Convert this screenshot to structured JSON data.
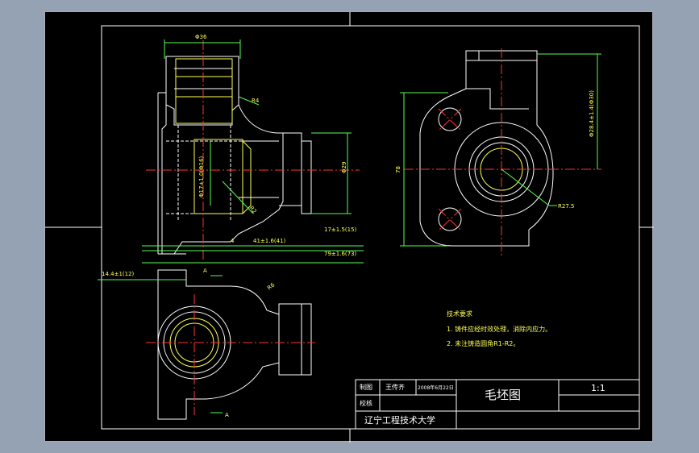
{
  "drawing": {
    "dimensions": {
      "d36": "Φ36",
      "r4": "R4",
      "d29": "Φ29",
      "d17": "Φ17±1.0(Φ16)",
      "r2": "R2",
      "d17_tol": "17±1.5(15)",
      "d41_tol": "41±1.6(41)",
      "d79_tol": "79±1.6(73)",
      "d14": "14.4±1(12)",
      "d4": "4",
      "r6": "R6",
      "d78": "78",
      "d29_right": "Φ28.4±1.4(Φ30)",
      "r27": "R27.5",
      "sec_a": "A"
    },
    "tech_requirements": {
      "title": "技术要求",
      "item1": "1. 铸件应经时效处理，消除内应力。",
      "item2": "2. 未注铸造圆角R1-R2。"
    },
    "title_block": {
      "drawn_label": "制图",
      "drawn_name": "王传齐",
      "date": "2008年6月22日",
      "check_label": "校核",
      "drawing_name": "毛坯图",
      "scale": "1:1",
      "school": "辽宁工程技术大学"
    }
  }
}
